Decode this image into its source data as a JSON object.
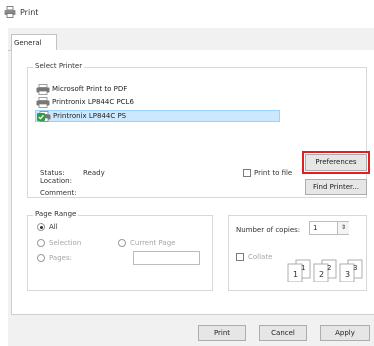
{
  "window": {
    "title": "Print"
  },
  "tabs": [
    {
      "label": "General",
      "active": true
    }
  ],
  "select_printer": {
    "legend": "Select Printer",
    "printers": [
      {
        "name": "Microsoft Print to PDF",
        "icon": "printer-icon",
        "selected": false
      },
      {
        "name": "Printronix LP844C PCL6",
        "icon": "printer-icon",
        "selected": false
      },
      {
        "name": "Printronix LP844C PS",
        "icon": "default-printer-icon",
        "selected": true
      }
    ],
    "status_label": "Status:",
    "status_value": "Ready",
    "location_label": "Location:",
    "comment_label": "Comment:",
    "print_to_file_label": "Print to file",
    "print_to_file_checked": false,
    "preferences_label": "Preferences",
    "find_printer_label": "Find Printer..."
  },
  "page_range": {
    "legend": "Page Range",
    "all_label": "All",
    "selection_label": "Selection",
    "current_page_label": "Current Page",
    "pages_label": "Pages:",
    "pages_value": "",
    "selected": "All"
  },
  "copies": {
    "number_label": "Number of copies:",
    "number_value": "1",
    "collate_label": "Collate",
    "collate_checked": false,
    "collate_pages": [
      "1",
      "1",
      "2",
      "2",
      "3",
      "3"
    ]
  },
  "footer": {
    "print_label": "Print",
    "cancel_label": "Cancel",
    "apply_label": "Apply"
  },
  "colors": {
    "highlight": "#e02020",
    "selection": "#cce8ff",
    "default_printer_badge": "#2f9e44"
  }
}
